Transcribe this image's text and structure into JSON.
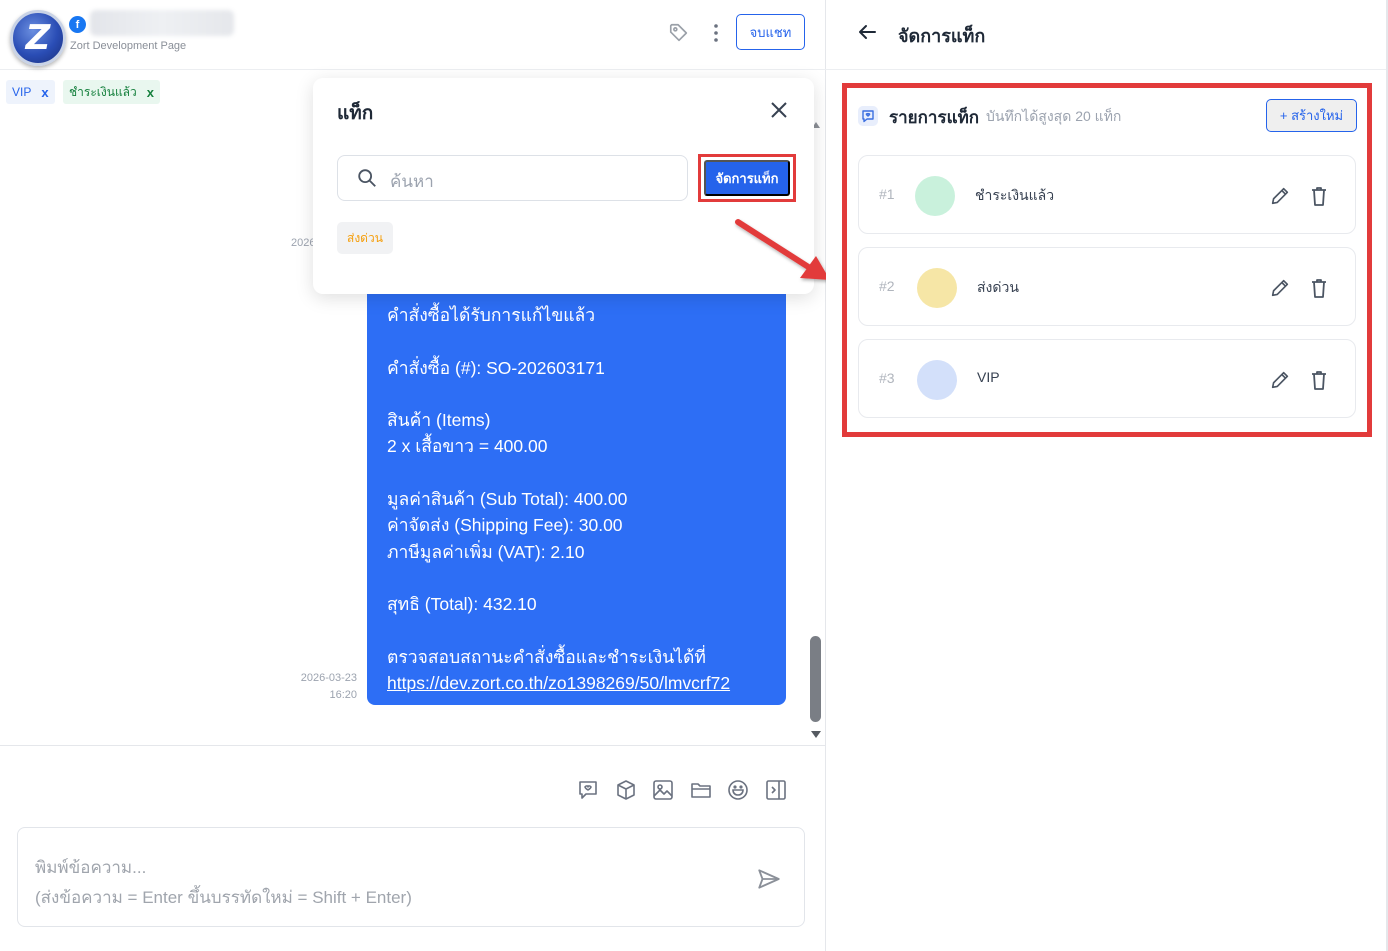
{
  "chat": {
    "page_name": "Zort Development Page",
    "end_chat_label": "จบแชท",
    "chips": [
      {
        "label": "VIP",
        "remove": "x"
      },
      {
        "label": "ชำระเงินแล้ว",
        "remove": "x"
      }
    ],
    "partial_timestamp": "2026",
    "message": {
      "lines": "คำสั่งซื้อได้รับการแก้ไขแล้ว\n\nคำสั่งซื้อ (#): SO-202603171\n\nสินค้า (Items)\n2 x เสื้อขาว = 400.00\n\nมูลค่าสินค้า (Sub Total): 400.00\nค่าจัดส่ง (Shipping Fee): 30.00\nภาษีมูลค่าเพิ่ม (VAT): 2.10\n\nสุทธิ (Total): 432.10\n\nตรวจสอบสถานะคำสั่งซื้อและชำระเงินได้ที่",
      "link": "https://dev.zort.co.th/zo1398269/50/lmvcrf72",
      "date": "2026-03-23",
      "time": "16:20"
    },
    "composer": {
      "placeholder_line1": "พิมพ์ข้อความ...",
      "placeholder_line2": "(ส่งข้อความ = Enter ขึ้นบรรทัดใหม่ = Shift + Enter)"
    },
    "toolbar_icons": [
      "chat-reply-icon",
      "package-icon",
      "image-icon",
      "folder-icon",
      "emoji-icon",
      "panel-toggle-icon"
    ]
  },
  "popup": {
    "title": "แท็ก",
    "search_placeholder": "ค้นหา",
    "manage_label": "จัดการแท็ก",
    "available_tags": [
      {
        "label": "ส่งด่วน",
        "color": "#f59e0b"
      }
    ]
  },
  "manage_panel": {
    "title": "จัดการแท็ก",
    "list_title": "รายการแท็ก",
    "list_subtitle": "บันทึกได้สูงสุด 20 แท็ก",
    "create_label": "+ สร้างใหม่",
    "tags": [
      {
        "index": "#1",
        "name": "ชำระเงินแล้ว",
        "color": "#c9f1dc"
      },
      {
        "index": "#2",
        "name": "ส่งด่วน",
        "color": "#f6e6a6"
      },
      {
        "index": "#3",
        "name": "VIP",
        "color": "#d3e0fa"
      }
    ]
  },
  "colors": {
    "accent": "#2563eb",
    "message_bubble": "#2d6ef5",
    "highlight": "#e23b3b"
  }
}
